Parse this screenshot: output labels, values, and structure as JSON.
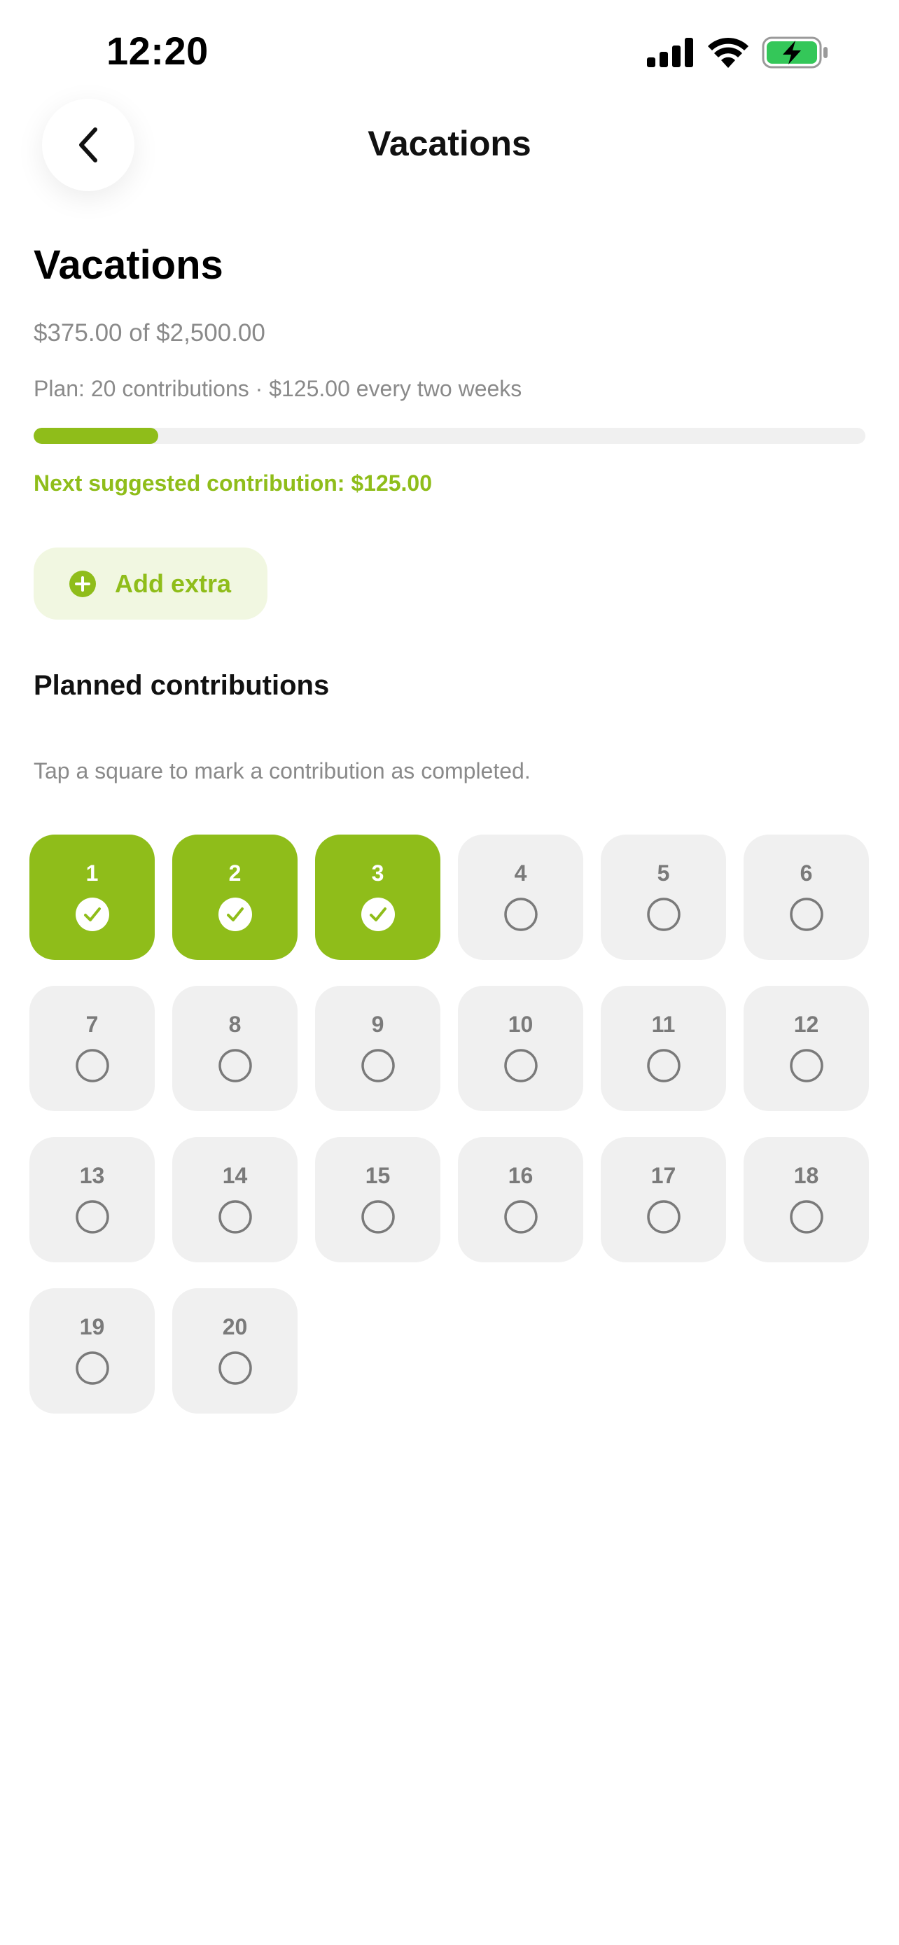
{
  "status_bar": {
    "time": "12:20",
    "icons": [
      "signal-icon",
      "wifi-icon",
      "battery-charging-icon"
    ]
  },
  "nav": {
    "back_icon": "chevron-left-icon",
    "title": "Vacations"
  },
  "goal": {
    "title": "Vacations",
    "amount_text": "$375.00 of $2,500.00",
    "plan_text": "Plan: 20 contributions · $125.00 every two weeks",
    "progress_fraction": 0.15,
    "suggested_text": "Next suggested contribution: $125.00"
  },
  "actions": {
    "add_extra_label": "Add extra",
    "add_extra_icon": "plus-circle-icon"
  },
  "contributions": {
    "section_title": "Planned contributions",
    "hint": "Tap a square to mark a contribution as completed.",
    "items": [
      {
        "label": "1",
        "completed": true
      },
      {
        "label": "2",
        "completed": true
      },
      {
        "label": "3",
        "completed": true
      },
      {
        "label": "4",
        "completed": false
      },
      {
        "label": "5",
        "completed": false
      },
      {
        "label": "6",
        "completed": false
      },
      {
        "label": "7",
        "completed": false
      },
      {
        "label": "8",
        "completed": false
      },
      {
        "label": "9",
        "completed": false
      },
      {
        "label": "10",
        "completed": false
      },
      {
        "label": "11",
        "completed": false
      },
      {
        "label": "12",
        "completed": false
      },
      {
        "label": "13",
        "completed": false
      },
      {
        "label": "14",
        "completed": false
      },
      {
        "label": "15",
        "completed": false
      },
      {
        "label": "16",
        "completed": false
      },
      {
        "label": "17",
        "completed": false
      },
      {
        "label": "18",
        "completed": false
      },
      {
        "label": "19",
        "completed": false
      },
      {
        "label": "20",
        "completed": false
      }
    ]
  },
  "colors": {
    "accent": "#8fbd1a",
    "accent_soft": "#f1f7e1",
    "tile_bg": "#f0f0f0",
    "muted_text": "#8a8a8a",
    "battery_green": "#34c759"
  }
}
